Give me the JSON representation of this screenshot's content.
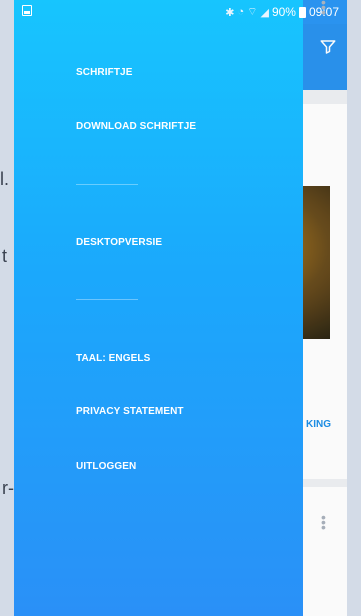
{
  "status_bar": {
    "battery": "90%",
    "time": "09:07"
  },
  "background_page": {
    "card_link_fragment": "KING",
    "edge_fragments": [
      "l.",
      "t",
      "r-"
    ]
  },
  "drawer": {
    "items": [
      {
        "label": "SCHRIFTJE"
      },
      {
        "label": "DOWNLOAD SCHRIFTJE"
      },
      {
        "label": "DESKTOPVERSIE"
      },
      {
        "label": "TAAL: ENGELS"
      },
      {
        "label": "PRIVACY STATEMENT"
      },
      {
        "label": "UITLOGGEN"
      }
    ]
  },
  "colors": {
    "drawer_top": "#17c5fe",
    "drawer_bottom": "#2a90f7",
    "header": "#2a93ef",
    "link": "#1c8fe8"
  },
  "icons": [
    "gallery-icon",
    "bluetooth-icon",
    "alarm-icon",
    "wifi-icon",
    "signal-icon",
    "battery-icon",
    "filter-icon",
    "more-vert-icon"
  ]
}
